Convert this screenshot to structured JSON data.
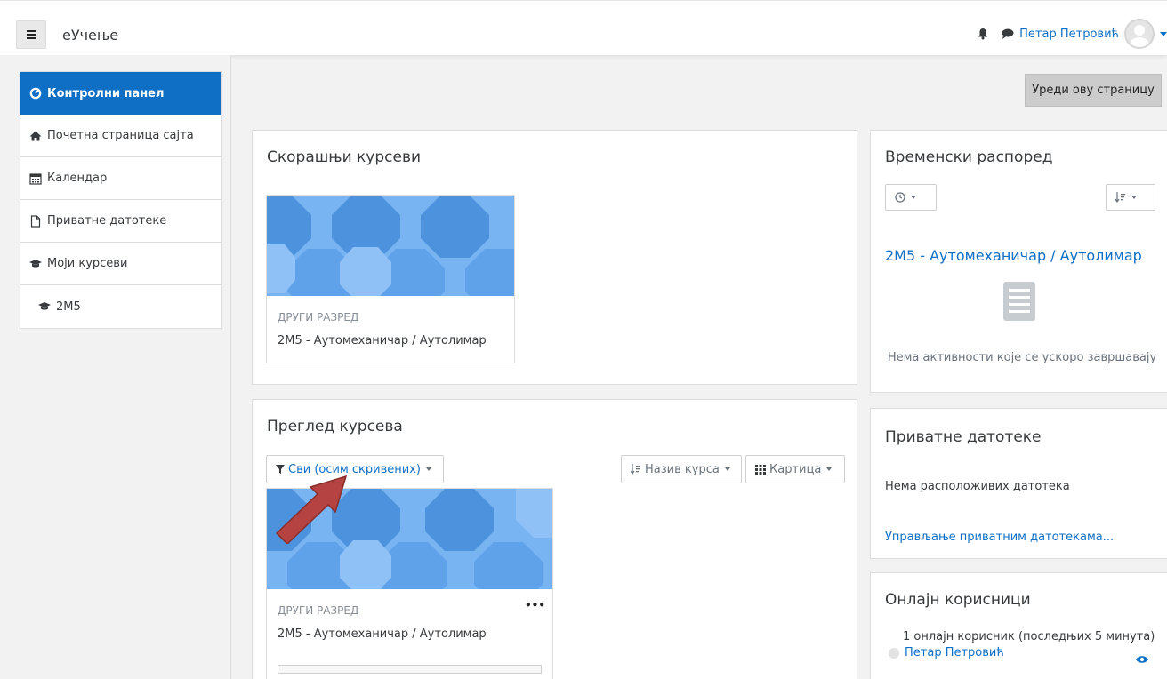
{
  "navbar": {
    "brand": "еУчење",
    "user_name": "Петар Петровић",
    "icons": [
      "hamburger-icon",
      "bell-icon",
      "chat-icon",
      "avatar-icon",
      "caret-down-icon"
    ],
    "accent": "#0f6fc5"
  },
  "sidebar": {
    "items": [
      {
        "label": "Контролни панел",
        "icon": "dashboard-icon"
      },
      {
        "label": "Почетна страница сајта",
        "icon": "home-icon"
      },
      {
        "label": "Календар",
        "icon": "calendar-icon"
      },
      {
        "label": "Приватне датотеке",
        "icon": "file-icon"
      },
      {
        "label": "Моји курсеви",
        "icon": "graduation-cap-icon"
      },
      {
        "label": "2M5",
        "icon": "graduation-cap-icon"
      }
    ]
  },
  "page": {
    "edit_button": "Уреди ову страницу"
  },
  "recent": {
    "title": "Скорашњи курсеви",
    "course_category": "ДРУГИ РАЗРЕД",
    "course_name": "2M5 - Аутомеханичар / Аутолимар"
  },
  "overview": {
    "title": "Преглед курсева",
    "filter_label": "Сви (осим скривених)",
    "sort_label": "Назив курса",
    "view_label": "Картица",
    "course_category": "ДРУГИ РАЗРЕД",
    "course_name": "2M5 - Аутомеханичар / Аутолимар",
    "menu_glyph": "•••"
  },
  "timeline": {
    "title": "Временски распоред",
    "course_link": "2M5 - Аутомеханичар / Аутолимар",
    "empty_text": "Нема активности које се ускоро завршавају"
  },
  "private_files": {
    "title": "Приватне датотеке",
    "empty_text": "Нема расположивих датотека",
    "manage_link": "Управљање приватним датотекама..."
  },
  "online_users": {
    "title": "Онлајн корисници",
    "summary": "1 онлајн корисник (последњих 5 минута)",
    "user_name": "Петар Петровић"
  }
}
